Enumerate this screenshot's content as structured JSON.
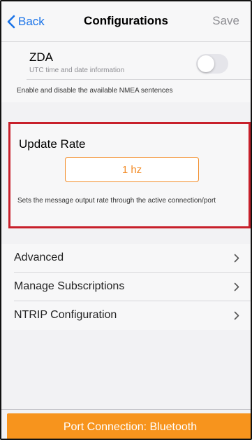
{
  "navbar": {
    "back_label": "Back",
    "title": "Configurations",
    "save_label": "Save"
  },
  "zda": {
    "title": "ZDA",
    "subtitle": "UTC time and date information",
    "toggle_on": false,
    "note": "Enable and disable the available NMEA sentences"
  },
  "update_rate": {
    "title": "Update Rate",
    "value": "1 hz",
    "description": "Sets the message output rate through the active connection/port"
  },
  "menu": {
    "items": [
      {
        "label": "Advanced"
      },
      {
        "label": "Manage Subscriptions"
      },
      {
        "label": "NTRIP Configuration"
      }
    ]
  },
  "footer": {
    "port_label": "Port Connection: Bluetooth"
  },
  "colors": {
    "accent": "#1a73e8",
    "orange": "#f7941d",
    "highlight_border": "#c8202b"
  }
}
